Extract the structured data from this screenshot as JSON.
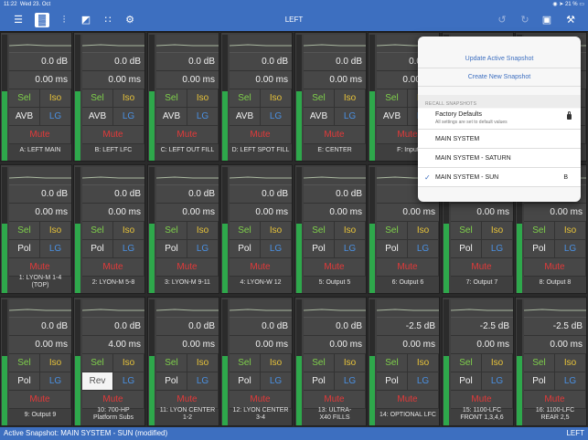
{
  "status_bar": {
    "time": "11:22",
    "date": "Wed 23. Oct",
    "battery": "21 %"
  },
  "toolbar": {
    "title": "LEFT"
  },
  "bottom_bar": {
    "active_snapshot": "Active Snapshot: MAIN SYSTEM - SUN (modified)",
    "right": "LEFT"
  },
  "popover": {
    "update_label": "Update Active Snapshot",
    "create_label": "Create New Snapshot",
    "section_header": "RECALL SNAPSHOTS",
    "factory": {
      "title": "Factory Defaults",
      "subtitle": "All settings are set to default values"
    },
    "snapshots": [
      {
        "label": "MAIN SYSTEM",
        "tag": "",
        "checked": false
      },
      {
        "label": "MAIN SYSTEM - SATURN",
        "tag": "",
        "checked": false
      },
      {
        "label": "MAIN SYSTEM - SUN",
        "tag": "B",
        "checked": true
      }
    ]
  },
  "channels": [
    {
      "gain": "0.0 dB",
      "delay": "0.00 ms",
      "b1": "Sel",
      "b2": "Iso",
      "b3": "AVB",
      "b4": "LG",
      "mute": "Mute",
      "name": [
        "A: LEFT MAIN"
      ],
      "level": 0.55
    },
    {
      "gain": "0.0 dB",
      "delay": "0.00 ms",
      "b1": "Sel",
      "b2": "Iso",
      "b3": "AVB",
      "b4": "LG",
      "mute": "Mute",
      "name": [
        "B: LEFT LFC"
      ],
      "level": 0.55
    },
    {
      "gain": "0.0 dB",
      "delay": "0.00 ms",
      "b1": "Sel",
      "b2": "Iso",
      "b3": "AVB",
      "b4": "LG",
      "mute": "Mute",
      "name": [
        "C: LEFT OUT FILL"
      ],
      "level": 0.55
    },
    {
      "gain": "0.0 dB",
      "delay": "0.00 ms",
      "b1": "Sel",
      "b2": "Iso",
      "b3": "AVB",
      "b4": "LG",
      "mute": "Mute",
      "name": [
        "D: LEFT SPOT FILL"
      ],
      "level": 0.55
    },
    {
      "gain": "0.0 dB",
      "delay": "0.00 ms",
      "b1": "Sel",
      "b2": "Iso",
      "b3": "AVB",
      "b4": "LG",
      "mute": "Mute",
      "name": [
        "E: CENTER"
      ],
      "level": 0.55
    },
    {
      "gain": "0.0 dB",
      "delay": "0.00 ms",
      "b1": "Sel",
      "b2": "Iso",
      "b3": "AVB",
      "b4": "LG",
      "mute": "Mute",
      "name": [
        "F: Input"
      ],
      "level": 0.55
    },
    {
      "gain": "",
      "delay": "",
      "b1": "",
      "b2": "",
      "b3": "",
      "b4": "",
      "mute": "",
      "name": [
        ""
      ],
      "level": 0.55
    },
    {
      "gain": "",
      "delay": "",
      "b1": "",
      "b2": "",
      "b3": "",
      "b4": "",
      "mute": "",
      "name": [
        ""
      ],
      "level": 0.55
    },
    {
      "gain": "0.0 dB",
      "delay": "0.00 ms",
      "b1": "Sel",
      "b2": "Iso",
      "b3": "Pol",
      "b4": "LG",
      "mute": "Mute",
      "name": [
        "1: LYON-M 1-4",
        "(TOP)"
      ],
      "level": 0.55
    },
    {
      "gain": "0.0 dB",
      "delay": "0.00 ms",
      "b1": "Sel",
      "b2": "Iso",
      "b3": "Pol",
      "b4": "LG",
      "mute": "Mute",
      "name": [
        "2: LYON-M 5-8"
      ],
      "level": 0.55
    },
    {
      "gain": "0.0 dB",
      "delay": "0.00 ms",
      "b1": "Sel",
      "b2": "Iso",
      "b3": "Pol",
      "b4": "LG",
      "mute": "Mute",
      "name": [
        "3: LYON-M 9-11"
      ],
      "level": 0.55
    },
    {
      "gain": "0.0 dB",
      "delay": "0.00 ms",
      "b1": "Sel",
      "b2": "Iso",
      "b3": "Pol",
      "b4": "LG",
      "mute": "Mute",
      "name": [
        "4: LYON-W 12"
      ],
      "level": 0.55
    },
    {
      "gain": "0.0 dB",
      "delay": "0.00 ms",
      "b1": "Sel",
      "b2": "Iso",
      "b3": "Pol",
      "b4": "LG",
      "mute": "Mute",
      "name": [
        "5: Output 5"
      ],
      "level": 0.55
    },
    {
      "gain": "",
      "delay": "0.00 ms",
      "b1": "Sel",
      "b2": "Iso",
      "b3": "Pol",
      "b4": "LG",
      "mute": "Mute",
      "name": [
        "6: Output 6"
      ],
      "level": 0.55
    },
    {
      "gain": "",
      "delay": "0.00 ms",
      "b1": "Sel",
      "b2": "Iso",
      "b3": "Pol",
      "b4": "LG",
      "mute": "Mute",
      "name": [
        "7: Output 7"
      ],
      "level": 0.55
    },
    {
      "gain": "",
      "delay": "0.00 ms",
      "b1": "Sel",
      "b2": "Iso",
      "b3": "Pol",
      "b4": "LG",
      "mute": "Mute",
      "name": [
        "8: Output 8"
      ],
      "level": 0.55
    },
    {
      "gain": "0.0 dB",
      "delay": "0.00 ms",
      "b1": "Sel",
      "b2": "Iso",
      "b3": "Pol",
      "b4": "LG",
      "mute": "Mute",
      "name": [
        "9: Output 9"
      ],
      "level": 0.55
    },
    {
      "gain": "0.0 dB",
      "delay": "4.00 ms",
      "b1": "Sel",
      "b2": "Iso",
      "b3": "Rev",
      "b4": "LG",
      "mute": "Mute",
      "name": [
        "10: 700-HP",
        "Platform Subs"
      ],
      "level": 0.55,
      "rev": true
    },
    {
      "gain": "0.0 dB",
      "delay": "0.00 ms",
      "b1": "Sel",
      "b2": "Iso",
      "b3": "Pol",
      "b4": "LG",
      "mute": "Mute",
      "name": [
        "11: LYON CENTER",
        "1-2"
      ],
      "level": 0.55
    },
    {
      "gain": "0.0 dB",
      "delay": "0.00 ms",
      "b1": "Sel",
      "b2": "Iso",
      "b3": "Pol",
      "b4": "LG",
      "mute": "Mute",
      "name": [
        "12: LYON CENTER",
        "3-4"
      ],
      "level": 0.55
    },
    {
      "gain": "0.0 dB",
      "delay": "0.00 ms",
      "b1": "Sel",
      "b2": "Iso",
      "b3": "Pol",
      "b4": "LG",
      "mute": "Mute",
      "name": [
        "13: ULTRA-",
        "X40 FILLS"
      ],
      "level": 0.55
    },
    {
      "gain": "-2.5 dB",
      "delay": "0.00 ms",
      "b1": "Sel",
      "b2": "Iso",
      "b3": "Pol",
      "b4": "LG",
      "mute": "Mute",
      "name": [
        "14: OPTIONAL LFC"
      ],
      "level": 0.55
    },
    {
      "gain": "-2.5 dB",
      "delay": "0.00 ms",
      "b1": "Sel",
      "b2": "Iso",
      "b3": "Pol",
      "b4": "LG",
      "mute": "Mute",
      "name": [
        "15: 1100-LFC",
        "FRONT 1,3,4,6"
      ],
      "level": 0.55
    },
    {
      "gain": "-2.5 dB",
      "delay": "0.00 ms",
      "b1": "Sel",
      "b2": "Iso",
      "b3": "Pol",
      "b4": "LG",
      "mute": "Mute",
      "name": [
        "16: 1100-LFC",
        "REAR 2,5"
      ],
      "level": 0.55
    }
  ]
}
